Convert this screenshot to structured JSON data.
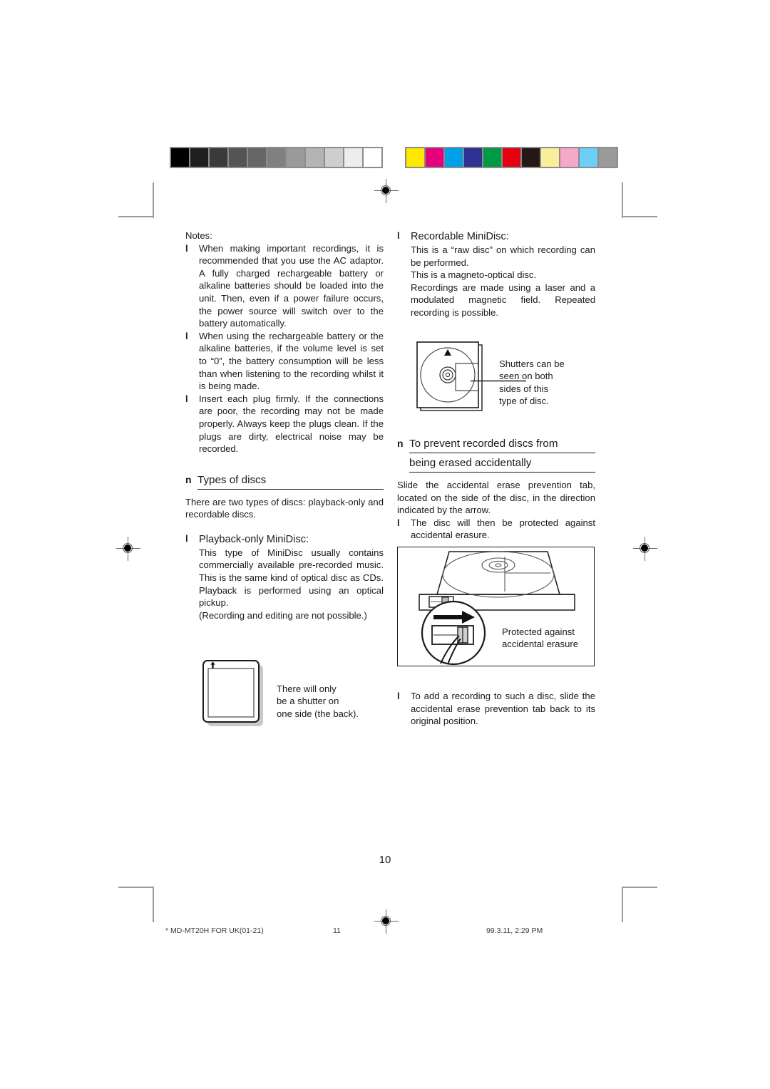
{
  "page": {
    "number": "10",
    "footer": {
      "file": "* MD-MT20H FOR UK(01-21)",
      "sheet": "11",
      "timestamp": "99.3.11, 2:29 PM"
    }
  },
  "calibration": {
    "grayscale_label": "grayscale-step-wedge",
    "grayscale": [
      "#000000",
      "#1e1e1e",
      "#3a3a3a",
      "#545454",
      "#666666",
      "#808080",
      "#9a9a9a",
      "#b4b4b4",
      "#cecece",
      "#ededed",
      "#ffffff"
    ],
    "color_label": "process-color-patches",
    "colors": [
      "#ffe800",
      "#e5007d",
      "#00a0e9",
      "#2e3192",
      "#009944",
      "#e60012",
      "#231815",
      "#faee9b",
      "#f5a8c8",
      "#6ecff6",
      "#9a9a9a"
    ]
  },
  "left_column": {
    "notes_label": "Notes:",
    "notes": [
      "When making important recordings, it is recommended that you use the AC adaptor. A fully charged rechargeable battery or alkaline batteries should be loaded into the unit. Then, even if a power failure occurs, the power source will switch over to the battery automatically.",
      "When using the rechargeable battery or the alkaline batteries, if the volume level is set to “0”, the battery consumption will be less than when listening to the recording whilst it is being made.",
      "Insert each plug firmly. If the connections are poor, the recording may not be made properly. Always keep the plugs clean. If the plugs are dirty, electrical noise may be recorded."
    ],
    "section": {
      "marker": "n",
      "title": "Types of discs",
      "intro": "There are two types of discs: playback-only and recordable discs."
    },
    "playback_only": {
      "marker": "l",
      "heading": "Playback-only MiniDisc:",
      "body": "This type of MiniDisc usually contains commercially available pre-recorded music. This is the same kind of optical disc as CDs. Playback is performed using an optical pickup.",
      "note": "(Recording and editing are not possible.)"
    },
    "figure_caption": "There will only\nbe a shutter on\none side (the back)."
  },
  "right_column": {
    "recordable": {
      "marker": "l",
      "heading": "Recordable MiniDisc:",
      "body_1": "This is a “raw disc” on which recording can be performed.",
      "body_2": "This is a magneto-optical disc.",
      "body_3": "Recordings are made using a laser and a modulated magnetic field. Repeated recording is possible."
    },
    "shutters_caption": "Shutters can be\nseen on both\nsides of this\ntype of disc.",
    "section": {
      "marker": "n",
      "title_line_1": "To prevent recorded discs from",
      "title_line_2": "being erased accidentally",
      "intro": "Slide the accidental erase prevention tab, located on the side of the disc, in the direction indicated by the arrow."
    },
    "protected_note": {
      "marker": "l",
      "text": "The disc will then be protected against accidental erasure."
    },
    "figure_caption": "Protected against\naccidental erasure",
    "add_recording_note": {
      "marker": "l",
      "text": "To add a recording to such a disc, slide the accidental erase prevention tab back to its original position."
    }
  }
}
